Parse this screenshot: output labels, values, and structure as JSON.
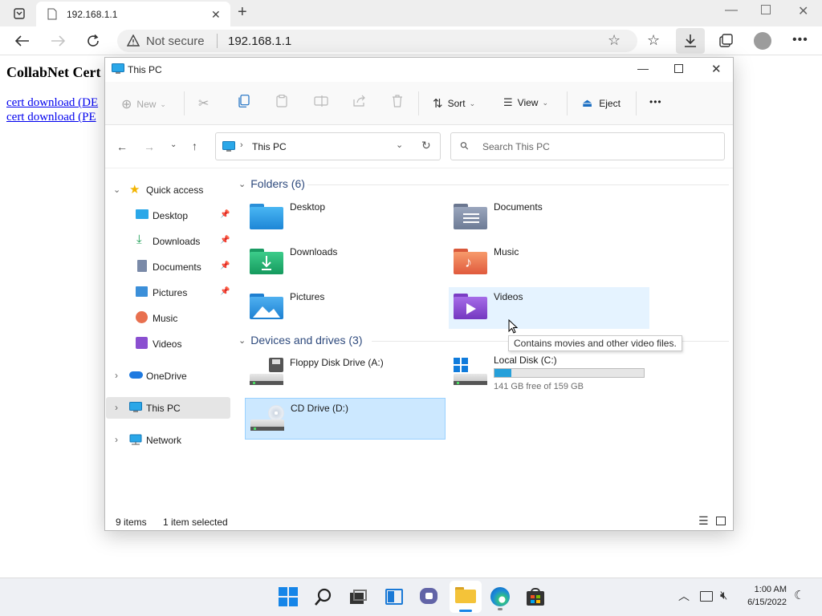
{
  "browser": {
    "tab_title": "192.168.1.1",
    "security_label": "Not secure",
    "url": "192.168.1.1"
  },
  "webpage": {
    "title": "CollabNet Cert",
    "links": [
      "cert download (DE",
      "cert download (PE"
    ]
  },
  "explorer": {
    "title": "This PC",
    "command_bar": {
      "new_label": "New",
      "sort_label": "Sort",
      "view_label": "View",
      "eject_label": "Eject",
      "more_label": "•••"
    },
    "address_path": "This PC",
    "search_placeholder": "Search This PC",
    "nav": {
      "quick_access": "Quick access",
      "quick_items": [
        {
          "label": "Desktop",
          "pinned": true
        },
        {
          "label": "Downloads",
          "pinned": true
        },
        {
          "label": "Documents",
          "pinned": true
        },
        {
          "label": "Pictures",
          "pinned": true
        },
        {
          "label": "Music",
          "pinned": false
        },
        {
          "label": "Videos",
          "pinned": false
        }
      ],
      "onedrive": "OneDrive",
      "this_pc": "This PC",
      "network": "Network"
    },
    "folders_header": "Folders (6)",
    "folders": [
      {
        "label": "Desktop",
        "icon": "desktop-folder-icon"
      },
      {
        "label": "Documents",
        "icon": "documents-folder-icon"
      },
      {
        "label": "Downloads",
        "icon": "downloads-folder-icon"
      },
      {
        "label": "Music",
        "icon": "music-folder-icon"
      },
      {
        "label": "Pictures",
        "icon": "pictures-folder-icon"
      },
      {
        "label": "Videos",
        "icon": "videos-folder-icon"
      }
    ],
    "devices_header": "Devices and drives (3)",
    "drives": {
      "floppy": "Floppy Disk Drive (A:)",
      "local_disk": "Local Disk (C:)",
      "local_disk_space": "141 GB free of 159 GB",
      "local_disk_used_fraction": 0.113,
      "cd_drive": "CD Drive (D:)"
    },
    "tooltip": "Contains movies and other video files.",
    "status": {
      "items": "9 items",
      "selected": "1 item selected"
    }
  },
  "taskbar": {
    "time": "1:00 AM",
    "date": "6/15/2022"
  },
  "colors": {
    "accent": "#0078d4",
    "folder_blue": "#3fa9f5",
    "selection": "#cce8ff",
    "hover": "#e5f3ff"
  }
}
